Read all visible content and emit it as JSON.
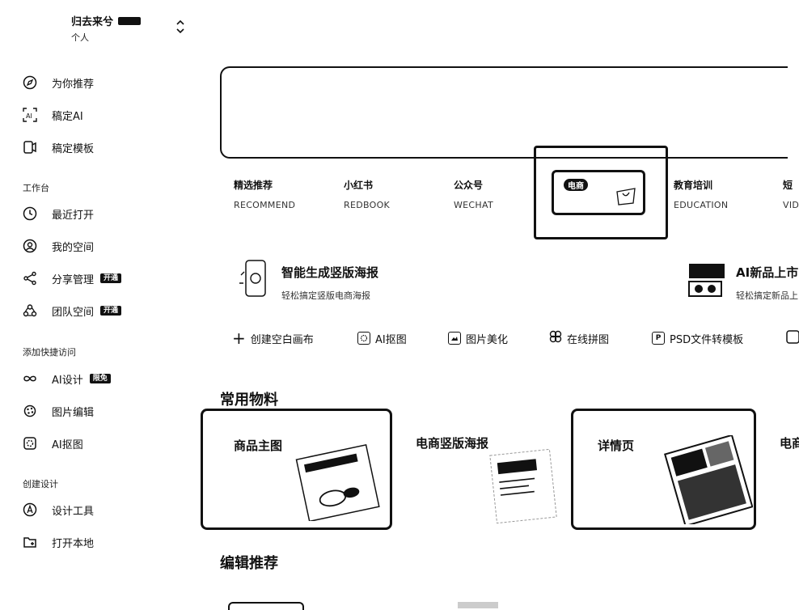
{
  "account": {
    "name": "归去来兮",
    "badge": "",
    "type": "个人"
  },
  "nav_top": [
    {
      "label": "为你推荐",
      "icon": "compass-icon"
    },
    {
      "label": "稿定AI",
      "icon": "ai-icon"
    },
    {
      "label": "稿定模板",
      "icon": "template-icon"
    }
  ],
  "workbench": {
    "title": "工作台",
    "items": [
      {
        "label": "最近打开",
        "icon": "clock-icon",
        "badge": ""
      },
      {
        "label": "我的空间",
        "icon": "user-circle-icon",
        "badge": ""
      },
      {
        "label": "分享管理",
        "icon": "share-icon",
        "badge": "开通"
      },
      {
        "label": "团队空间",
        "icon": "team-icon",
        "badge": "开通"
      }
    ]
  },
  "quick_access": {
    "title": "添加快捷访问",
    "items": [
      {
        "label": "AI设计",
        "icon": "infinity-icon",
        "badge": "限免"
      },
      {
        "label": "图片编辑",
        "icon": "brush-icon",
        "badge": ""
      },
      {
        "label": "AI抠图",
        "icon": "cutout-icon",
        "badge": ""
      }
    ]
  },
  "create_design": {
    "title": "创建设计",
    "items": [
      {
        "label": "设计工具",
        "icon": "design-tool-icon"
      },
      {
        "label": "打开本地",
        "icon": "folder-add-icon"
      }
    ]
  },
  "categories": [
    {
      "zh": "精选推荐",
      "en": "RECOMMEND"
    },
    {
      "zh": "小红书",
      "en": "REDBOOK"
    },
    {
      "zh": "公众号",
      "en": "WECHAT"
    },
    {
      "zh": "教育培训",
      "en": "EDUCATION"
    },
    {
      "zh": "短",
      "en": "VID"
    }
  ],
  "selected_category_tag": "电商",
  "promos": [
    {
      "title": "智能生成竖版海报",
      "subtitle": "轻松搞定竖版电商海报"
    },
    {
      "title": "AI新品上市",
      "subtitle": "轻松搞定新品上"
    }
  ],
  "tools": [
    {
      "label": "创建空白画布",
      "icon": "plus-icon"
    },
    {
      "label": "AI抠图",
      "icon": "cutout-icon"
    },
    {
      "label": "图片美化",
      "icon": "image-enhance-icon"
    },
    {
      "label": "在线拼图",
      "icon": "collage-icon"
    },
    {
      "label": "PSD文件转模板",
      "icon": "psd-icon"
    }
  ],
  "sections": {
    "common_materials": "常用物料",
    "editor_picks": "编辑推荐"
  },
  "material_cards": [
    {
      "title": "商品主图"
    },
    {
      "title": "电商竖版海报"
    },
    {
      "title": "详情页"
    },
    {
      "title": "电商"
    }
  ]
}
